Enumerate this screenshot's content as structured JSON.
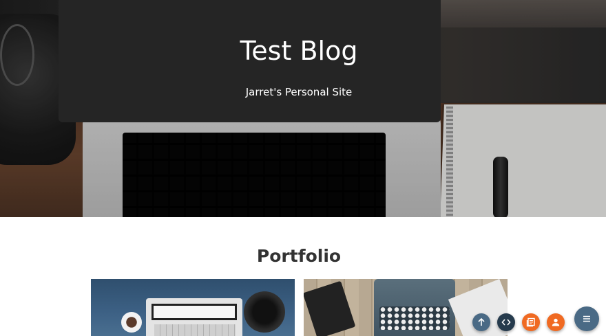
{
  "hero": {
    "title": "Test Blog",
    "subtitle": "Jarret's Personal Site"
  },
  "portfolio": {
    "title": "Portfolio",
    "items": [
      {
        "image": "laptop-desk-photo"
      },
      {
        "image": "typewriter-desk-photo"
      }
    ]
  },
  "fabs": [
    {
      "icon": "arrow-up-icon",
      "color": "#4a6a85"
    },
    {
      "icon": "code-icon",
      "color": "#263b4d"
    },
    {
      "icon": "blog-icon",
      "color": "#f06a22"
    },
    {
      "icon": "person-icon",
      "color": "#f06a22"
    },
    {
      "icon": "menu-icon",
      "color": "#4a6a85"
    }
  ]
}
